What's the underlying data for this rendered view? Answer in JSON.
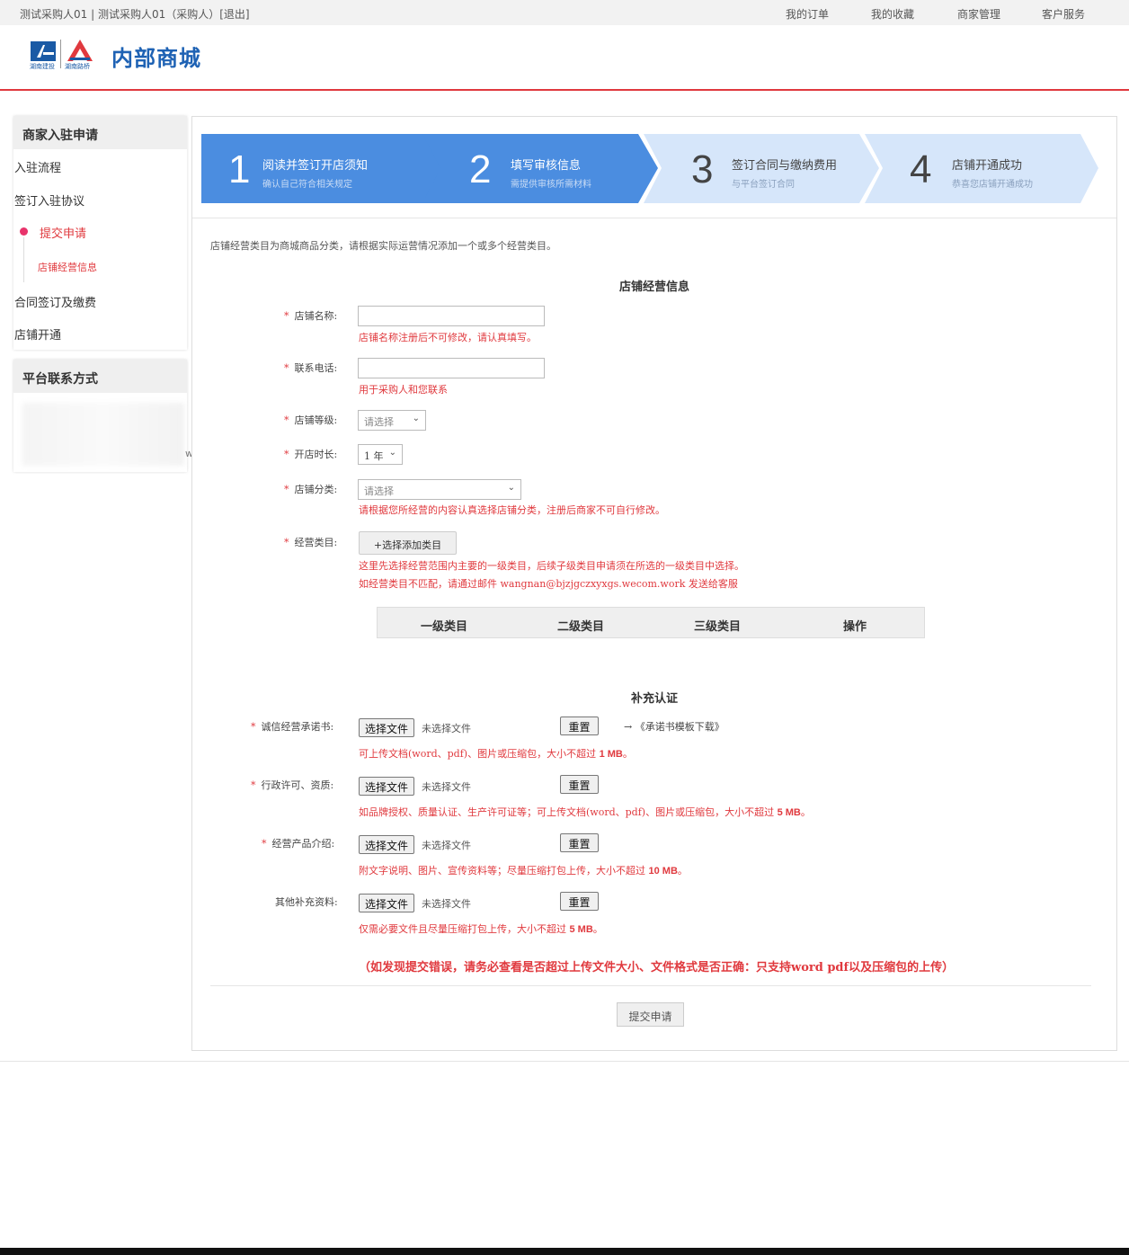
{
  "topbar": {
    "user_info": "测试采购人01 | 测试采购人01（采购人）[退出]",
    "nav": [
      "我的订单",
      "我的收藏",
      "商家管理",
      "客户服务"
    ]
  },
  "header": {
    "logo1_caption": "湖南建投",
    "logo2_caption": "湖南路桥",
    "brand": "内部商城"
  },
  "sidebar": {
    "apply_title": "商家入驻申请",
    "menu": [
      "入驻流程",
      "签订入驻协议",
      "提交申请",
      "店铺经营信息",
      "合同签订及缴费",
      "店铺开通"
    ],
    "contact_title": "平台联系方式",
    "contact_blurred_fragment": "work"
  },
  "steps": [
    {
      "num": "1",
      "title": "阅读并签订开店须知",
      "sub": "确认自己符合相关规定"
    },
    {
      "num": "2",
      "title": "填写审核信息",
      "sub": "需提供审核所需材料"
    },
    {
      "num": "3",
      "title": "签订合同与缴纳费用",
      "sub": "与平台签订合同"
    },
    {
      "num": "4",
      "title": "店铺开通成功",
      "sub": "恭喜您店铺开通成功"
    }
  ],
  "form": {
    "intro": "店铺经营类目为商城商品分类，请根据实际运营情况添加一个或多个经营类目。",
    "section_title": "店铺经营信息",
    "required_mark": "*",
    "shop_name_label": "店铺名称:",
    "shop_name_hint": "店铺名称注册后不可修改，请认真填写。",
    "phone_label": "联系电话:",
    "phone_hint": "用于采购人和您联系",
    "level_label": "店铺等级:",
    "level_value": "请选择",
    "duration_label": "开店时长:",
    "duration_value": "1 年",
    "category_label": "店铺分类:",
    "category_value": "请选择",
    "category_hint": "请根据您所经营的内容认真选择店铺分类，注册后商家不可自行修改。",
    "biz_label": "经营类目:",
    "biz_button": "+选择添加类目",
    "biz_hint1": "这里先选择经营范围内主要的一级类目，后续子级类目申请须在所选的一级类目中选择。",
    "biz_hint2": "如经营类目不匹配，请通过邮件 wangnan@bjzjgczxyxgs.wecom.work 发送给客服",
    "table_headers": [
      "一级类目",
      "二级类目",
      "三级类目",
      "操作"
    ]
  },
  "supplement": {
    "title": "补充认证",
    "choose_file": "选择文件",
    "no_file": "未选择文件",
    "reset": "重置",
    "template_link": "→ 《承诺书模板下载》",
    "rows": [
      {
        "label": "诚信经营承诺书:",
        "required": true,
        "hint_pre": "可上传文档(word、pdf)、图片或压缩包，大小不超过 ",
        "hint_size": "1 MB",
        "hint_post": "。"
      },
      {
        "label": "行政许可、资质:",
        "required": true,
        "hint_pre": "如品牌授权、质量认证、生产许可证等；可上传文档(word、pdf)、图片或压缩包，大小不超过 ",
        "hint_size": "5 MB",
        "hint_post": "。"
      },
      {
        "label": "经营产品介绍:",
        "required": true,
        "hint_pre": "附文字说明、图片、宣传资料等；尽量压缩打包上传，大小不超过 ",
        "hint_size": "10 MB",
        "hint_post": "。"
      },
      {
        "label": "其他补充资料:",
        "required": false,
        "hint_pre": "仅需必要文件且尽量压缩打包上传，大小不超过 ",
        "hint_size": "5 MB",
        "hint_post": "。"
      }
    ],
    "warning": "（如发现提交错误，请务必查看是否超过上传文件大小、文件格式是否正确：只支持word pdf以及压缩包的上传）",
    "submit": "提交申请"
  },
  "colors": {
    "accent_red": "#e0393e",
    "step_active_blue": "#4b8de0",
    "step_inactive": "#d6e6fa",
    "brand_blue": "#1e62b4"
  }
}
